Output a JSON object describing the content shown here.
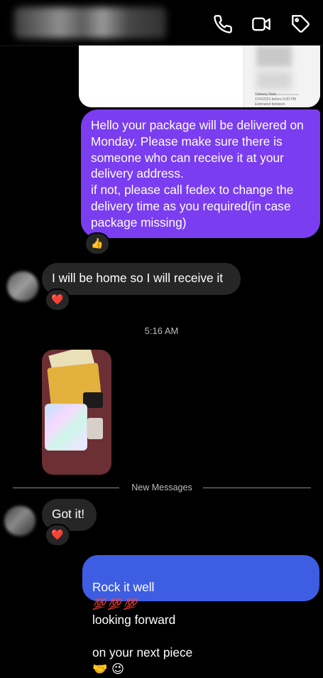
{
  "header": {
    "contact_name": "",
    "call_icon": "phone-icon",
    "video_icon": "video-camera-icon",
    "tag_icon": "tag-icon"
  },
  "receipt": {
    "small_text_1": "Delivery Date",
    "small_text_2": "1/24/2023 before 6:00 PM",
    "small_text_3": "Estimated between"
  },
  "messages": {
    "m1_text": "Hello your package will be delivered on Monday. Please make sure there is someone who can receive it at your delivery address.\nif not, please call fedex to change the delivery time as you required(in case package missing)",
    "m1_reaction": "👍",
    "m2_text": "I will be home so I will receive it",
    "m2_reaction": "❤️",
    "timestamp": "5:16 AM",
    "new_messages_label": "New Messages",
    "m3_text": "Got it!",
    "m3_reaction": "❤️",
    "m4_text_part1": "Rock it well",
    "m4_hundreds": "💯 💯 💯",
    "m4_text_part2": "looking forward",
    "m4_text_part3": "on your next piece",
    "m4_emojis": "🤝 😉"
  },
  "colors": {
    "outgoing_purple": "#7b3df0",
    "outgoing_blue": "#3d5de2",
    "incoming_gray": "#262626",
    "background": "#000000"
  }
}
